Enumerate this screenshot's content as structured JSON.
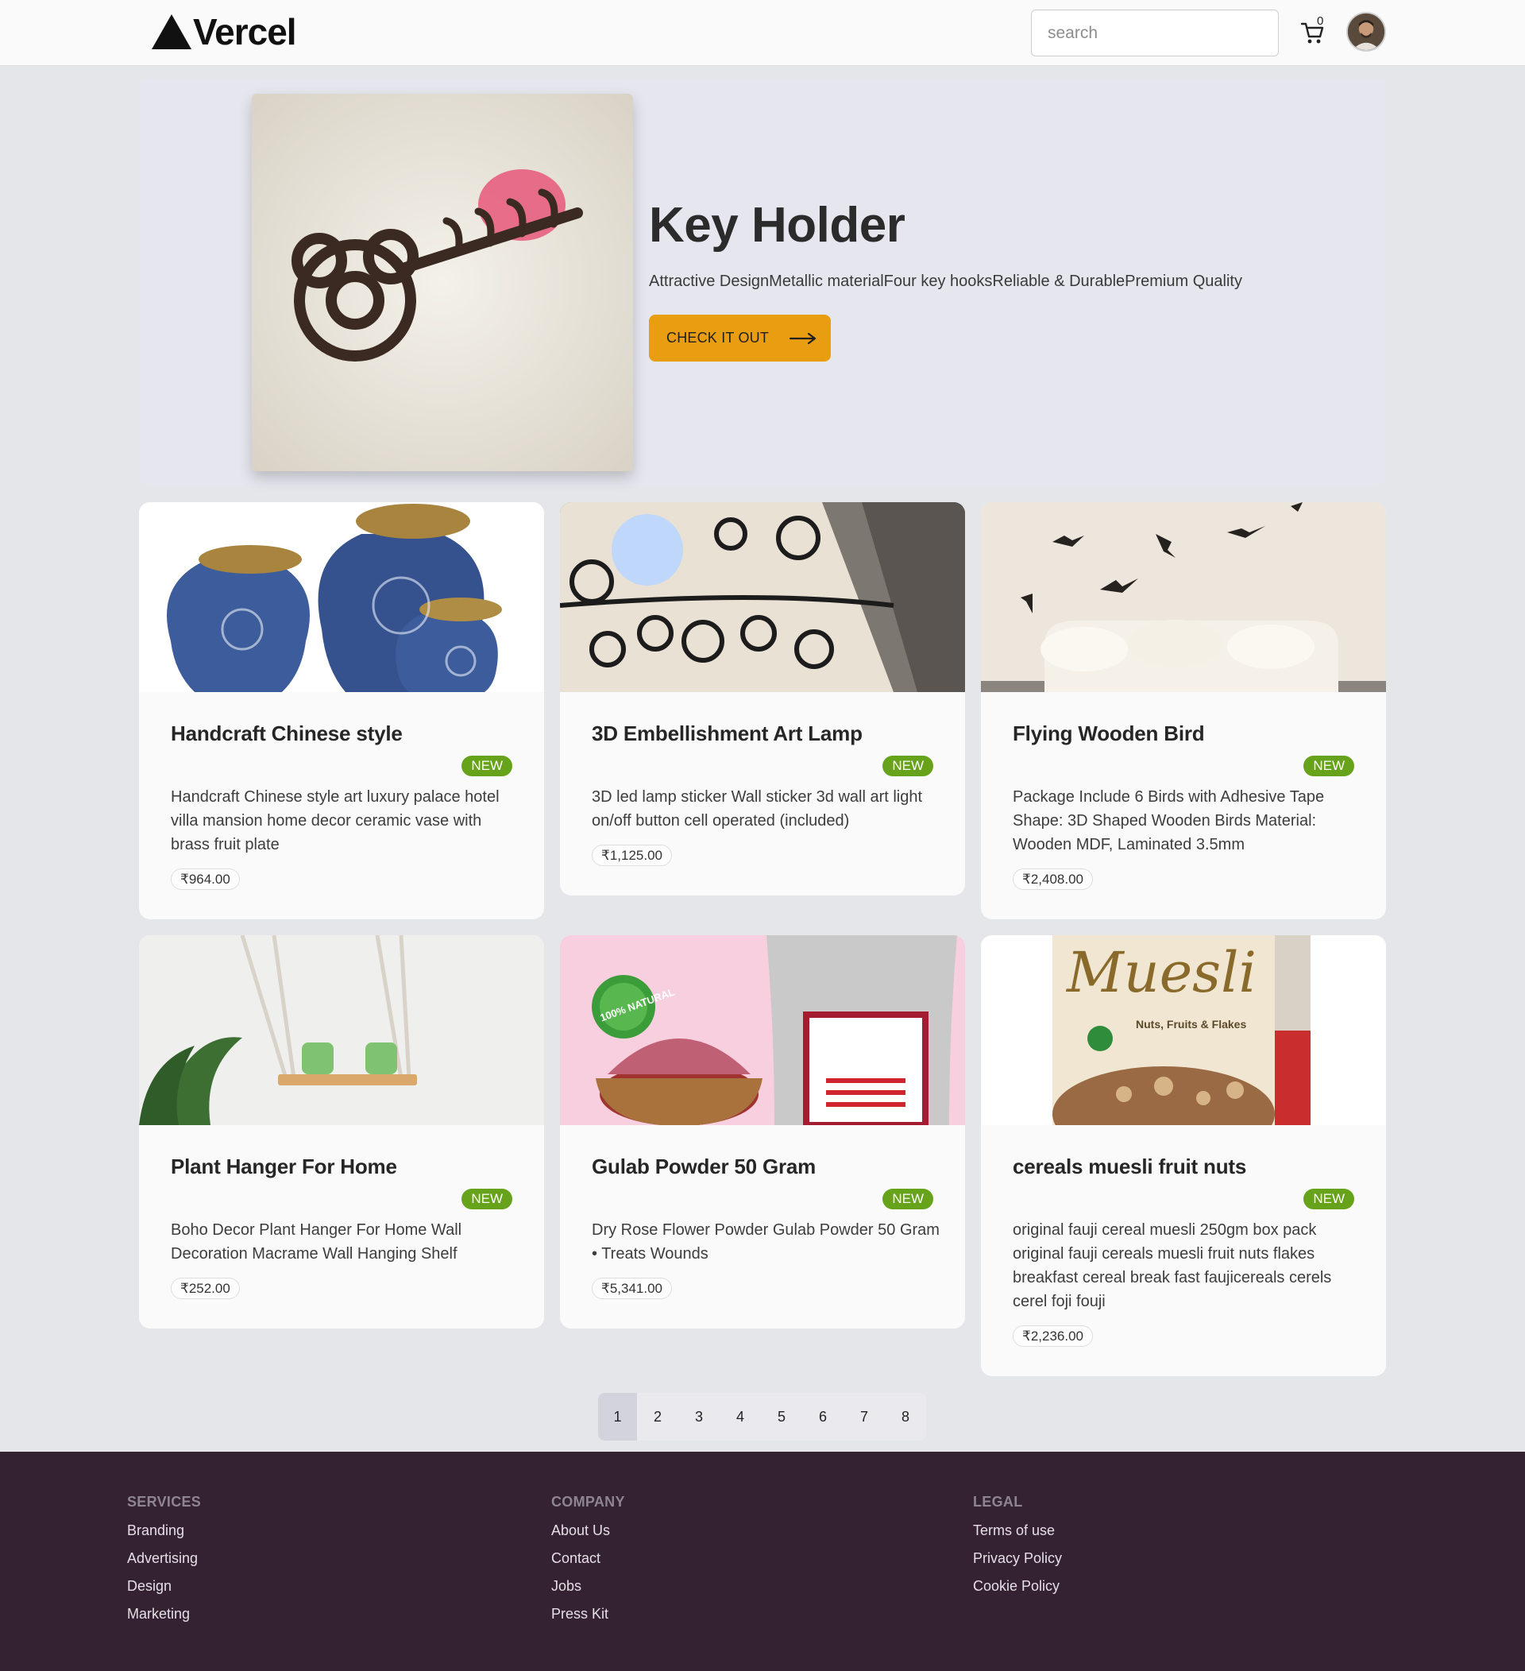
{
  "header": {
    "brand": "Vercel",
    "search_placeholder": "search",
    "cart_count": "0"
  },
  "hero": {
    "title": "Key Holder",
    "description": "Attractive DesignMetallic materialFour key hooksReliable & DurablePremium Quality",
    "button_label": "CHECK IT OUT"
  },
  "products": [
    {
      "title": "Handcraft Chinese style",
      "badge": "NEW",
      "description": "Handcraft Chinese style art luxury palace hotel villa mansion home decor ceramic vase with brass fruit plate",
      "price": "₹964.00"
    },
    {
      "title": "3D Embellishment Art Lamp",
      "badge": "NEW",
      "description": "3D led lamp sticker Wall sticker 3d wall art light on/off button cell operated (included)",
      "price": "₹1,125.00"
    },
    {
      "title": "Flying Wooden Bird",
      "badge": "NEW",
      "description": "Package Include 6 Birds with Adhesive Tape Shape: 3D Shaped Wooden Birds Material: Wooden MDF, Laminated 3.5mm",
      "price": "₹2,408.00"
    },
    {
      "title": "Plant Hanger For Home",
      "badge": "NEW",
      "description": "Boho Decor Plant Hanger For Home Wall Decoration Macrame Wall Hanging Shelf",
      "price": "₹252.00"
    },
    {
      "title": "Gulab Powder 50 Gram",
      "badge": "NEW",
      "description": "Dry Rose Flower Powder Gulab Powder 50 Gram • Treats Wounds",
      "price": "₹5,341.00"
    },
    {
      "title": "cereals muesli fruit nuts",
      "badge": "NEW",
      "description": "original fauji cereal muesli 250gm box pack original fauji cereals muesli fruit nuts flakes breakfast cereal break fast faujicereals cerels cerel foji fouji",
      "price": "₹2,236.00"
    }
  ],
  "product_images": {
    "muesli_brand": "Muesli",
    "muesli_tagline": "Nuts, Fruits & Flakes",
    "natural_badge": "100% NATURAL"
  },
  "pagination": {
    "pages": [
      "1",
      "2",
      "3",
      "4",
      "5",
      "6",
      "7",
      "8"
    ],
    "current": "1"
  },
  "footer": {
    "services": {
      "heading": "SERVICES",
      "links": [
        "Branding",
        "Advertising",
        "Design",
        "Marketing"
      ]
    },
    "company": {
      "heading": "COMPANY",
      "links": [
        "About Us",
        "Contact",
        "Jobs",
        "Press Kit"
      ]
    },
    "legal": {
      "heading": "LEGAL",
      "links": [
        "Terms of use",
        "Privacy Policy",
        "Cookie Policy"
      ]
    }
  },
  "colors": {
    "accent": "#e99e12",
    "badge": "#66a31b",
    "footer_bg": "#342232"
  }
}
